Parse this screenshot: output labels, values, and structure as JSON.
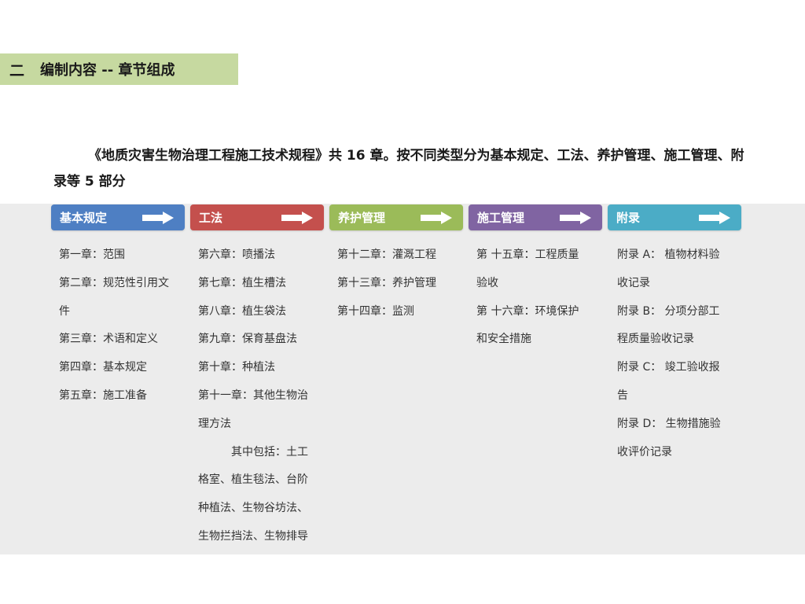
{
  "section": {
    "number": "二",
    "title": "编制内容 -- 章节组成"
  },
  "intro": "《地质灾害生物治理工程施工技术规程》共 16 章。按不同类型分为基本规定、工法、养护管理、施工管理、附录等 5 部分",
  "colors": {
    "title_band": "#c6d9a0",
    "panel": "#ececec",
    "col1": "#4e7fc3",
    "col2": "#c4504d",
    "col3": "#9bbb59",
    "col4": "#8064a2",
    "col5": "#4bacc6"
  },
  "columns": [
    {
      "label": "基本规定",
      "icon": "arrow-right-icon",
      "lines": [
        "第一章：范围",
        "第二章：规范性引用文",
        "件",
        "第三章：术语和定义",
        "第四章：基本规定",
        "第五章：施工准备"
      ]
    },
    {
      "label": "工法",
      "icon": "arrow-right-icon",
      "lines": [
        "第六章：喷播法",
        "第七章：植生槽法",
        "第八章：植生袋法",
        "第九章：保育基盘法",
        "第十章：种植法",
        "第十一章：其他生物治",
        "理方法",
        "其中包括：土工",
        "格室、植生毯法、台阶",
        "种植法、生物谷坊法、",
        "生物拦挡法、生物排导"
      ]
    },
    {
      "label": "养护管理",
      "icon": "arrow-right-icon",
      "lines": [
        "第十二章：灌溉工程",
        "第十三章：养护管理",
        "第十四章：监测"
      ]
    },
    {
      "label": "施工管理",
      "icon": "arrow-right-icon",
      "lines": [
        "第 十五章：工程质量",
        "验收",
        "第 十六章：环境保护",
        "和安全措施"
      ]
    },
    {
      "label": "附录",
      "icon": "arrow-right-icon",
      "lines": [
        "附录 A： 植物材料验",
        "收记录",
        "附录 B： 分项分部工",
        "程质量验收记录",
        "附录 C： 竣工验收报",
        "告",
        "附录 D： 生物措施验",
        "收评价记录"
      ]
    }
  ]
}
